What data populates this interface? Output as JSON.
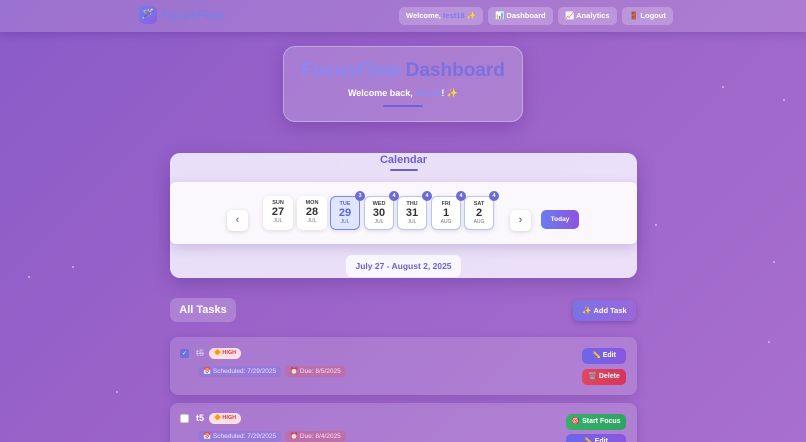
{
  "nav": {
    "logo_icon": "🪄",
    "logo_text": "FocusFlow",
    "welcome_prefix": "Welcome, ",
    "welcome_user": "test18",
    "welcome_suffix": " ✨",
    "dashboard": "📊 Dashboard",
    "analytics": "📈 Analytics",
    "logout": "🚪 Logout"
  },
  "hero": {
    "title_part1": "FocusFlow",
    "title_part2": " Dashboard",
    "welcome_prefix": "Welcome back, ",
    "welcome_user": "test18",
    "welcome_suffix": "! ✨"
  },
  "calendar": {
    "title": "Calendar",
    "prev": "‹",
    "next": "›",
    "today_button": "Today",
    "days": [
      {
        "name": "SUN",
        "date": "27",
        "month": "JUL",
        "count": ""
      },
      {
        "name": "MON",
        "date": "28",
        "month": "JUL",
        "count": ""
      },
      {
        "name": "TUE",
        "date": "29",
        "month": "JUL",
        "count": "3"
      },
      {
        "name": "WED",
        "date": "30",
        "month": "JUL",
        "count": "4"
      },
      {
        "name": "THU",
        "date": "31",
        "month": "JUL",
        "count": "4"
      },
      {
        "name": "FRI",
        "date": "1",
        "month": "AUG",
        "count": "4"
      },
      {
        "name": "SAT",
        "date": "2",
        "month": "AUG",
        "count": "4"
      }
    ],
    "range": "July 27 - August 2, 2025"
  },
  "tasks": {
    "heading": "All Tasks",
    "add_button": "✨ Add Task",
    "items": [
      {
        "completed": true,
        "check": "✓",
        "name": "t5",
        "priority": "🔶 HIGH",
        "scheduled": "📅 Scheduled: 7/29/2025",
        "due": "⏰ Due: 8/5/2025",
        "buttons": [
          "✏️ Edit",
          "🗑️ Delete"
        ]
      },
      {
        "completed": false,
        "check": "",
        "name": "t5",
        "priority": "🔶 HIGH",
        "scheduled": "📅 Scheduled: 7/29/2025",
        "due": "⏰ Due: 8/4/2025",
        "buttons": [
          "🎯 Start Focus",
          "✏️ Edit"
        ]
      }
    ]
  }
}
